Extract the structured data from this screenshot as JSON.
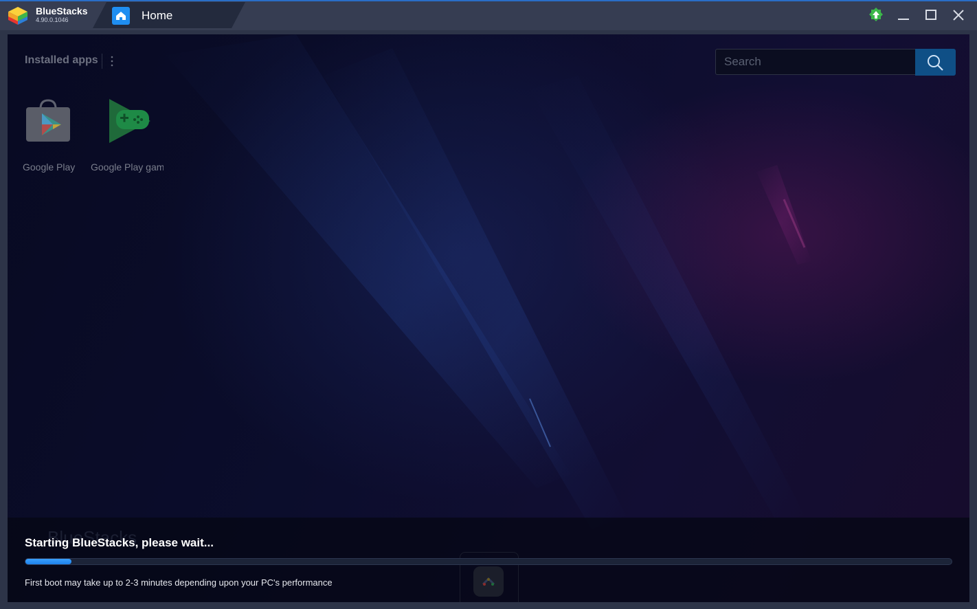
{
  "window": {
    "app_name": "BlueStacks",
    "version": "4.90.0.1046",
    "tab_label": "Home",
    "accent_color": "#1f8ef1"
  },
  "titlebar": {
    "buttons": [
      "update-icon",
      "minimize-icon",
      "maximize-icon",
      "close-icon"
    ]
  },
  "home": {
    "section_title": "Installed apps",
    "search": {
      "placeholder": "Search",
      "value": ""
    },
    "apps": [
      {
        "name": "Google Play",
        "icon": "google-play-store-icon"
      },
      {
        "name": "Google Play games",
        "icon": "google-play-games-icon"
      }
    ]
  },
  "loading": {
    "watermark": "BlueStacks",
    "title": "Starting BlueStacks, please wait...",
    "subtitle": "First boot may take up to 2-3 minutes depending upon your PC's performance",
    "progress_percent": 5
  }
}
